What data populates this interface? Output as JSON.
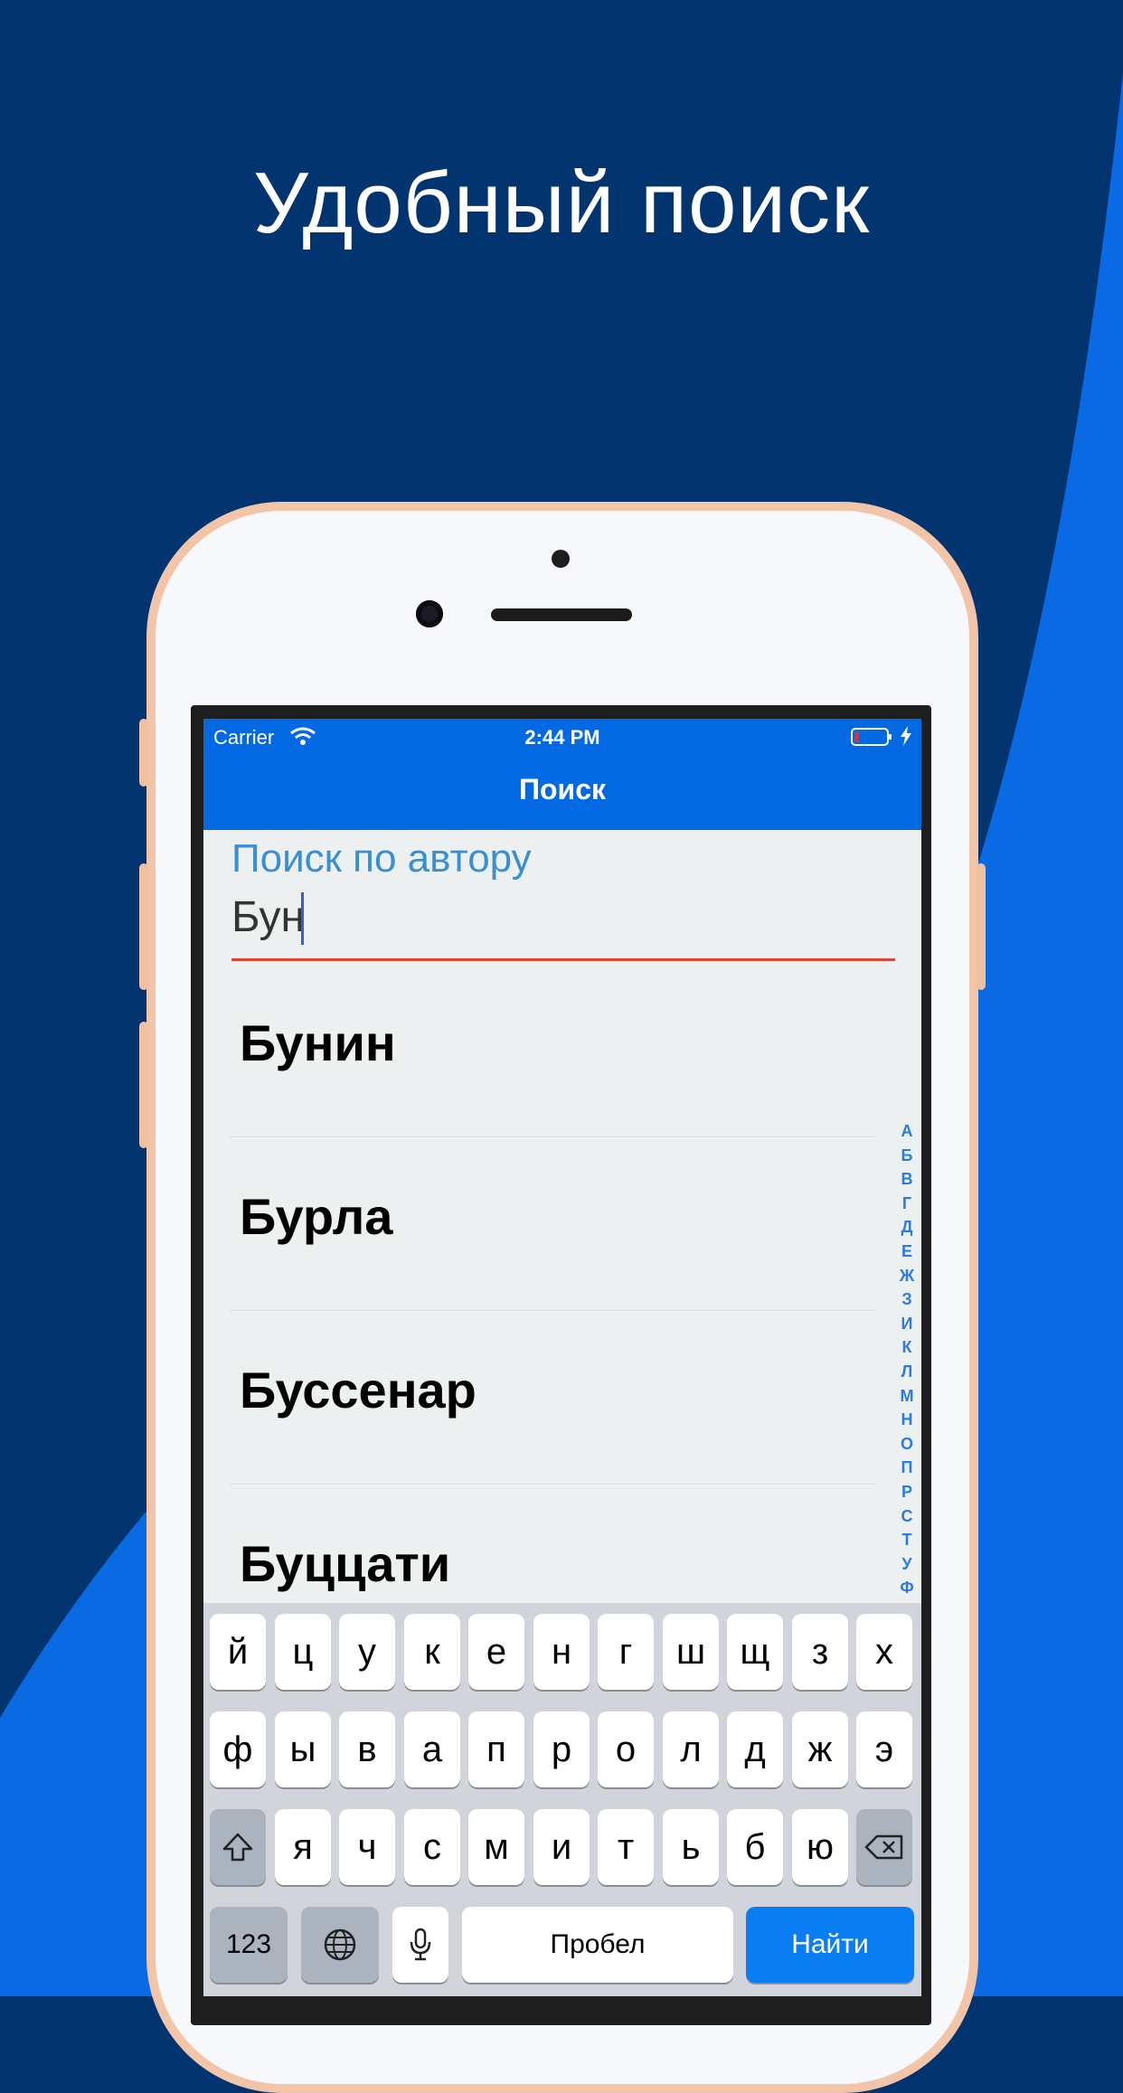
{
  "headline": "Удобный поиск",
  "colors": {
    "background": "#02346f",
    "accent": "#0369e2",
    "wave": "#0a6ae3",
    "underline": "#d9473a"
  },
  "status_bar": {
    "carrier": "Carrier",
    "time": "2:44 PM"
  },
  "nav": {
    "title": "Поиск"
  },
  "search": {
    "label": "Поиск по автору",
    "value": "Бун"
  },
  "results": [
    "Бунин",
    "Бурла",
    "Буссенар",
    "Буццати"
  ],
  "index_letters": [
    "А",
    "Б",
    "В",
    "Г",
    "Д",
    "Е",
    "Ж",
    "З",
    "И",
    "К",
    "Л",
    "М",
    "Н",
    "О",
    "П",
    "Р",
    "С",
    "Т",
    "У",
    "Ф"
  ],
  "keyboard": {
    "row1": [
      "й",
      "ц",
      "у",
      "к",
      "е",
      "н",
      "г",
      "ш",
      "щ",
      "з",
      "х"
    ],
    "row2": [
      "ф",
      "ы",
      "в",
      "а",
      "п",
      "р",
      "о",
      "л",
      "д",
      "ж",
      "э"
    ],
    "row3": [
      "я",
      "ч",
      "с",
      "м",
      "и",
      "т",
      "ь",
      "б",
      "ю"
    ],
    "numbers_label": "123",
    "space_label": "Пробел",
    "go_label": "Найти",
    "icons": {
      "shift": "shift-icon",
      "backspace": "backspace-icon",
      "globe": "globe-icon",
      "mic": "microphone-icon"
    }
  }
}
